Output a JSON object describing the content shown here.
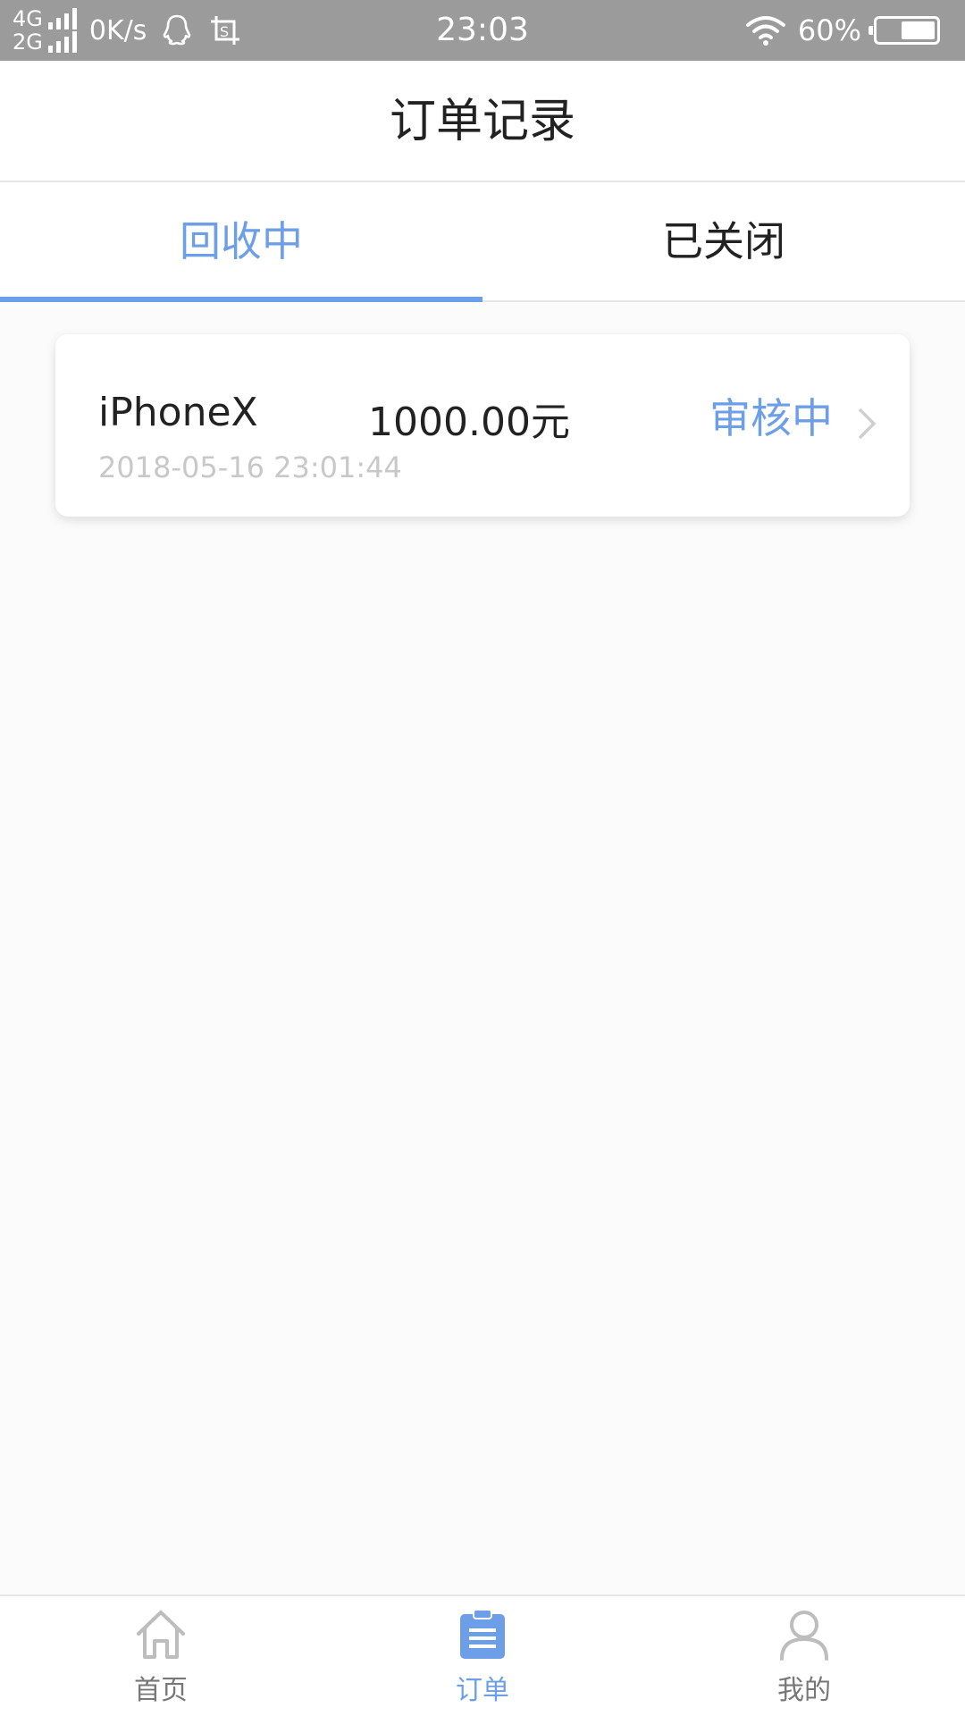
{
  "status_bar": {
    "net_top": "4G",
    "net_bottom": "2G",
    "speed": "0K/s",
    "time": "23:03",
    "battery": "60%",
    "battery_level": 0.6
  },
  "header": {
    "title": "订单记录"
  },
  "tabs": [
    {
      "label": "回收中",
      "active": true
    },
    {
      "label": "已关闭",
      "active": false
    }
  ],
  "orders": [
    {
      "product": "iPhoneX",
      "amount": "1000.00元",
      "status": "审核中",
      "date": "2018-05-16 23:01:44"
    }
  ],
  "bottom_nav": [
    {
      "label": "首页",
      "icon": "home-icon",
      "active": false
    },
    {
      "label": "订单",
      "icon": "order-clipboard-icon",
      "active": true
    },
    {
      "label": "我的",
      "icon": "user-icon",
      "active": false
    }
  ],
  "colors": {
    "accent": "#6d9ee8",
    "status_bar": "#9b9b9b",
    "background": "#fbfbfb"
  }
}
